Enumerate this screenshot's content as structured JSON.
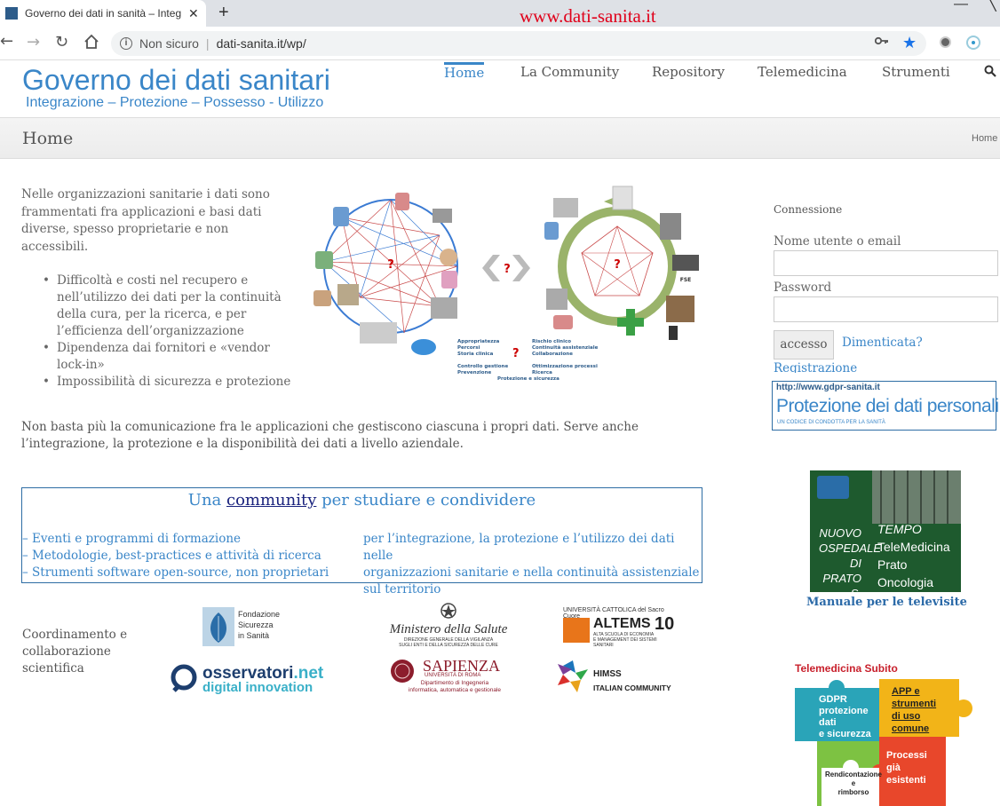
{
  "browser": {
    "tab_title": "Governo dei dati in sanità – Integ",
    "watermark": "www.dati-sanita.it",
    "security_label": "Non sicuro",
    "separator": "|",
    "url": "dati-sanita.it/wp/"
  },
  "site": {
    "title": "Governo dei dati sanitari",
    "subtitle": "Integrazione – Protezione – Possesso - Utilizzo",
    "menu": [
      "Home",
      "La Community",
      "Repository",
      "Telemedicina",
      "Strumenti"
    ]
  },
  "page": {
    "title": "Home",
    "breadcrumb": "Home"
  },
  "content": {
    "intro": "Nelle organizzazioni sanitarie i dati sono frammentati fra applicazioni e basi dati diverse, spesso proprietarie e non accessibili.",
    "bullets": [
      "Difficoltà e costi nel recupero e nell’utilizzo dei dati per la continuità della cura, per la ricerca, e per l’efficienza dell’organizzazione",
      "Dipendenza dai fornitori e «vendor lock-in»",
      "Impossibilità di sicurezza e protezione"
    ],
    "paragraph": "Non basta più la comunicazione fra le applicazioni che gestiscono ciascuna i propri dati. Serve anche l’integrazione, la protezione e la disponibilità dei dati a livello aziendale.",
    "community": {
      "title_before": "Una ",
      "title_link": "community",
      "title_after": " per studiare e condividere",
      "left_lines": [
        "– Eventi e programmi di formazione",
        "– Metodologie, best-practices e attività di ricerca",
        "– Strumenti software open-source, non proprietari"
      ],
      "right_lines": [
        "per l’integrazione, la protezione e l’utilizzo dei dati nelle",
        "organizzazioni sanitarie e nella continuità assistenziale",
        "sul territorio"
      ]
    },
    "coordination": "Coordinamento e collaborazione scientifica",
    "diagram": {
      "q": "?",
      "fse": "FSE",
      "col1": [
        "Appropriatezza",
        "Percorsi",
        "Storia clinica"
      ],
      "col2": [
        "Rischio clinico",
        "Continuità assistenziale",
        "Collaborazione"
      ],
      "col3": [
        "Controllo gestione",
        "Prevenzione"
      ],
      "col4": [
        "Ottimizzazione processi",
        "Ricerca"
      ],
      "col5": "Protezione e sicurezza"
    }
  },
  "logos": {
    "fondazione": [
      "Fondazione",
      "Sicurezza",
      "in Sanità"
    ],
    "ministero": "Ministero della Salute",
    "ministero_sub": [
      "DIREZIONE GENERALE DELLA VIGILANZA",
      "SUGLI ENTI E DELLA SICUREZZA DELLE CURE"
    ],
    "cattolica": "UNIVERSITÀ CATTOLICA del Sacro Cuore",
    "altems": "ALTEMS",
    "altems_sub": [
      "ALTA SCUOLA DI ECONOMIA",
      "E MANAGEMENT DEI SISTEMI SANITARI"
    ],
    "altems_ten": "10",
    "osservatori": "osservatori",
    "osservatori_dot": ".net",
    "osservatori_sub": "digital innovation",
    "sapienza": "SAPIENZA",
    "sapienza_sub": [
      "UNIVERSITÀ DI ROMA",
      "Dipartimento di Ingegneria",
      "informatica, automatica e gestionale"
    ],
    "himss": "HIMSS",
    "himss_sub": "ITALIAN COMMUNITY"
  },
  "sidebar": {
    "login_heading": "Connessione",
    "username_label": "Nome utente o email",
    "password_label": "Password",
    "login_button": "accesso",
    "forgot_link": "Dimenticata?",
    "register_link": "Registrazione",
    "gdpr_url": "http://www.gdpr-sanita.it",
    "gdpr_title": "Protezione dei dati personali",
    "gdpr_sub": "UN CODICE DI CONDOTTA PER LA SANITÀ",
    "tempo": {
      "hospital": [
        "NUOVO",
        "OSPEDALE",
        "DI PRATO",
        "S. STEFANO"
      ],
      "tempo_title": "TEMPO",
      "lines": [
        "TeleMedicina",
        "Prato",
        "Oncologia"
      ]
    },
    "manual_link": "Manuale per le televisite",
    "puzzle": {
      "title": "Telemedicina Subito",
      "p1": [
        "GDPR",
        "protezione",
        "dati",
        "e sicurezza"
      ],
      "p2": [
        "APP e",
        "strumenti",
        "di uso",
        "comune"
      ],
      "p3": [
        "Rendicontazione",
        "e",
        "rimborso"
      ],
      "p4": [
        "Processi",
        "già",
        "esistenti"
      ]
    }
  }
}
